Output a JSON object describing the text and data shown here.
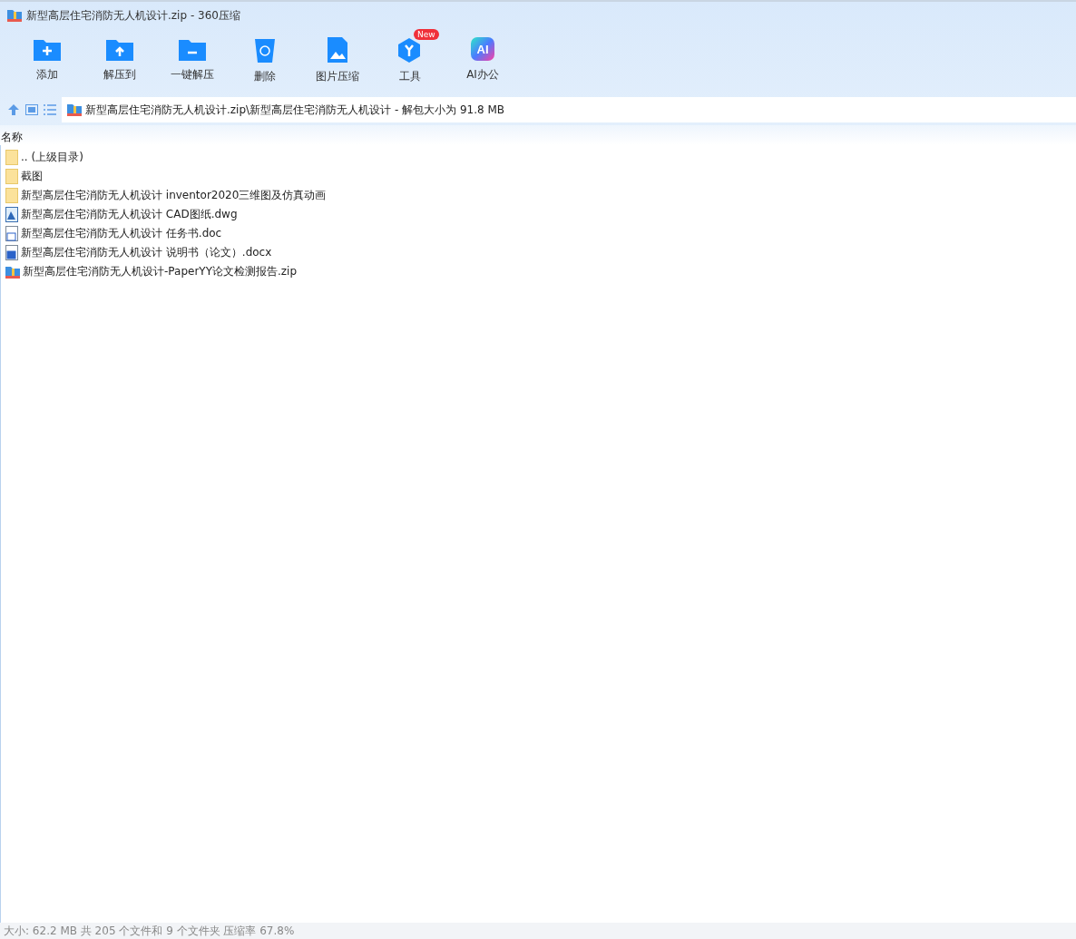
{
  "window": {
    "title": "新型高层住宅消防无人机设计.zip - 360压缩"
  },
  "toolbar": [
    {
      "kind": "add",
      "label": "添加"
    },
    {
      "kind": "extract",
      "label": "解压到"
    },
    {
      "kind": "quick",
      "label": "一键解压"
    },
    {
      "kind": "delete",
      "label": "删除"
    },
    {
      "kind": "image",
      "label": "图片压缩"
    },
    {
      "kind": "tools",
      "label": "工具",
      "badge": "New"
    },
    {
      "kind": "ai",
      "label": "AI办公",
      "glyph": "AI"
    }
  ],
  "address": {
    "path": "新型高层住宅消防无人机设计.zip\\新型高层住宅消防无人机设计 - 解包大小为 91.8 MB"
  },
  "table": {
    "columns": [
      "名称"
    ],
    "rows": [
      {
        "kind": "folder",
        "name": ".. (上级目录)"
      },
      {
        "kind": "folder",
        "name": "截图"
      },
      {
        "kind": "folder",
        "name": "新型高层住宅消防无人机设计 inventor2020三维图及仿真动画"
      },
      {
        "kind": "dwg",
        "name": "新型高层住宅消防无人机设计 CAD图纸.dwg"
      },
      {
        "kind": "doc",
        "name": "新型高层住宅消防无人机设计 任务书.doc"
      },
      {
        "kind": "docx",
        "name": "新型高层住宅消防无人机设计 说明书（论文）.docx"
      },
      {
        "kind": "zip",
        "name": "新型高层住宅消防无人机设计-PaperYY论文检测报告.zip"
      }
    ]
  },
  "status_bar": "大小: 62.2 MB 共 205 个文件和 9 个文件夹 压缩率 67.8%"
}
